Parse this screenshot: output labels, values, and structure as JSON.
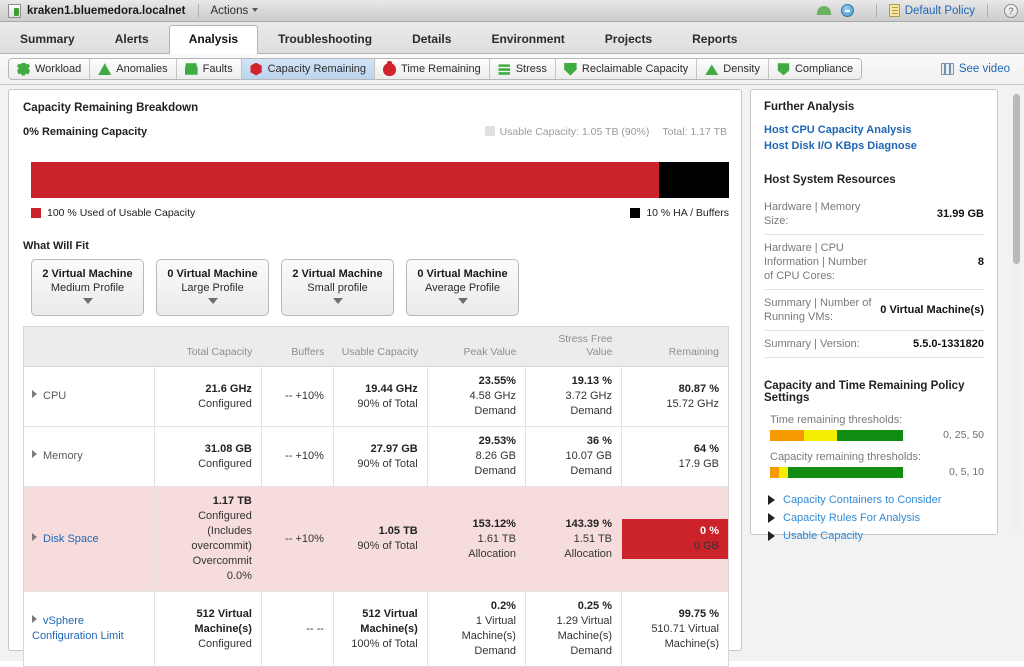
{
  "topbar": {
    "host_icon": "host-icon",
    "host_name": "kraken1.bluemedora.localnet",
    "actions_label": "Actions",
    "cloud_icon": "cloud-icon",
    "status_icon": "status-circle-icon",
    "policy_icon": "policy-icon",
    "policy_label": "Default Policy",
    "help_label": "?"
  },
  "main_tabs": [
    {
      "label": "Summary",
      "active": false
    },
    {
      "label": "Alerts",
      "active": false
    },
    {
      "label": "Analysis",
      "active": true
    },
    {
      "label": "Troubleshooting",
      "active": false
    },
    {
      "label": "Details",
      "active": false
    },
    {
      "label": "Environment",
      "active": false
    },
    {
      "label": "Projects",
      "active": false
    },
    {
      "label": "Reports",
      "active": false
    }
  ],
  "sub_tabs": [
    {
      "label": "Workload",
      "icon": "gear-badge-icon",
      "color": "#3fab42",
      "shape": "shp-gear",
      "selected": false
    },
    {
      "label": "Anomalies",
      "icon": "triangle-badge-icon",
      "color": "#3fab42",
      "shape": "shp-tri",
      "selected": false
    },
    {
      "label": "Faults",
      "icon": "stack-badge-icon",
      "color": "#3fab42",
      "shape": "shp-stack",
      "selected": false
    },
    {
      "label": "Capacity Remaining",
      "icon": "hexagon-badge-icon",
      "color": "#d2232a",
      "shape": "shp-hex",
      "selected": true
    },
    {
      "label": "Time Remaining",
      "icon": "clock-badge-icon",
      "color": "#d2232a",
      "shape": "shp-clock",
      "selected": false
    },
    {
      "label": "Stress",
      "icon": "bar-badge-icon",
      "color": "#3fab42",
      "shape": "shp-bar",
      "selected": false
    },
    {
      "label": "Reclaimable Capacity",
      "icon": "shield-badge-icon",
      "color": "#3fab42",
      "shape": "shp-shield",
      "selected": false
    },
    {
      "label": "Density",
      "icon": "mountain-badge-icon",
      "color": "#3fab42",
      "shape": "shp-mtn",
      "selected": false
    },
    {
      "label": "Compliance",
      "icon": "bolt-badge-icon",
      "color": "#3fab42",
      "shape": "shp-bolt",
      "selected": false
    }
  ],
  "see_video": {
    "label": "See video",
    "icon": "video-icon"
  },
  "breakdown": {
    "title": "Capacity Remaining Breakdown",
    "remaining_headline": "0% Remaining Capacity",
    "usable_capacity_label": "Usable Capacity: 1.05 TB (90%)",
    "total_label": "Total: 1.17 TB",
    "used_legend": "100 % Used of Usable Capacity",
    "ha_legend": "10 % HA / Buffers",
    "used_color": "#cc2229",
    "ha_color": "#000000",
    "used_pct": 90,
    "ha_pct": 10
  },
  "what_will_fit": {
    "title": "What Will Fit",
    "cards": [
      {
        "count": "2 Virtual Machine",
        "profile": "Medium Profile"
      },
      {
        "count": "0 Virtual Machine",
        "profile": "Large Profile"
      },
      {
        "count": "2 Virtual Machine",
        "profile": "Small profile"
      },
      {
        "count": "0 Virtual Machine",
        "profile": "Average Profile"
      }
    ]
  },
  "table": {
    "columns": [
      "",
      "Total Capacity",
      "Buffers",
      "Usable Capacity",
      "Peak Value",
      "Stress Free Value",
      "Remaining"
    ],
    "rows": [
      {
        "name": "CPU",
        "alert": false,
        "name_link": false,
        "total": {
          "main": "21.6 GHz",
          "sub": [
            "Configured"
          ]
        },
        "buffers": {
          "main": "",
          "sub": [
            "--  +10%"
          ]
        },
        "usable": {
          "main": "19.44 GHz",
          "sub": [
            "90% of Total"
          ]
        },
        "peak": {
          "main": "23.55%",
          "sub": [
            "4.58 GHz",
            "Demand"
          ]
        },
        "stress_free": {
          "main": "19.13 %",
          "sub": [
            "3.72 GHz",
            "Demand"
          ]
        },
        "remaining": {
          "main": "80.87 %",
          "sub": [
            "15.72 GHz"
          ],
          "highlight": false
        }
      },
      {
        "name": "Memory",
        "alert": false,
        "name_link": false,
        "total": {
          "main": "31.08 GB",
          "sub": [
            "Configured"
          ]
        },
        "buffers": {
          "main": "",
          "sub": [
            "--  +10%"
          ]
        },
        "usable": {
          "main": "27.97 GB",
          "sub": [
            "90% of Total"
          ]
        },
        "peak": {
          "main": "29.53%",
          "sub": [
            "8.26 GB",
            "Demand"
          ]
        },
        "stress_free": {
          "main": "36 %",
          "sub": [
            "10.07 GB",
            "Demand"
          ]
        },
        "remaining": {
          "main": "64 %",
          "sub": [
            "17.9 GB"
          ],
          "highlight": false
        }
      },
      {
        "name": "Disk Space",
        "alert": true,
        "name_link": true,
        "total": {
          "main": "1.17 TB",
          "sub": [
            "Configured",
            "(Includes",
            "overcommit)",
            "Overcommit",
            "0.0%"
          ]
        },
        "buffers": {
          "main": "",
          "sub": [
            "--  +10%"
          ]
        },
        "usable": {
          "main": "1.05 TB",
          "sub": [
            "90% of Total"
          ]
        },
        "peak": {
          "main": "153.12%",
          "sub": [
            "1.61 TB",
            "Allocation"
          ]
        },
        "stress_free": {
          "main": "143.39 %",
          "sub": [
            "1.51 TB",
            "Allocation"
          ]
        },
        "remaining": {
          "main": "0 %",
          "sub": [
            "0 GB"
          ],
          "highlight": true
        }
      },
      {
        "name": "vSphere Configuration Limit",
        "alert": false,
        "name_link": true,
        "total": {
          "main": "512 Virtual Machine(s)",
          "sub": [
            "Configured"
          ]
        },
        "buffers": {
          "main": "",
          "sub": [
            "--  --"
          ]
        },
        "usable": {
          "main": "512 Virtual Machine(s)",
          "sub": [
            "100% of Total"
          ]
        },
        "peak": {
          "main": "0.2%",
          "sub": [
            "1 Virtual",
            "Machine(s)",
            "Demand"
          ]
        },
        "stress_free": {
          "main": "0.25 %",
          "sub": [
            "1.29 Virtual",
            "Machine(s)",
            "Demand"
          ]
        },
        "remaining": {
          "main": "99.75 %",
          "sub": [
            "510.71 Virtual",
            "Machine(s)"
          ],
          "highlight": false
        }
      }
    ]
  },
  "further_analysis": {
    "title": "Further Analysis",
    "links": [
      "Host CPU Capacity Analysis",
      "Host Disk I/O KBps Diagnose"
    ]
  },
  "host_system_resources": {
    "title": "Host System Resources",
    "rows": [
      {
        "label": "Hardware | Memory Size:",
        "value": "31.99 GB"
      },
      {
        "label": "Hardware | CPU Information | Number of CPU Cores:",
        "value": "8"
      },
      {
        "label": "Summary | Number of Running VMs:",
        "value": "0 Virtual Machine(s)"
      },
      {
        "label": "Summary | Version:",
        "value": "5.5.0-1331820"
      }
    ]
  },
  "policy_settings": {
    "title": "Capacity and Time Remaining Policy Settings",
    "time_remaining": {
      "label": "Time remaining thresholds:",
      "values": "0, 25, 50",
      "segments": [
        {
          "color": "#f59a00",
          "width": 34
        },
        {
          "color": "#f5ee00",
          "width": 33
        },
        {
          "color": "#108c10",
          "width": 66
        }
      ]
    },
    "capacity_remaining": {
      "label": "Capacity remaining thresholds:",
      "values": "0, 5, 10",
      "segments": [
        {
          "color": "#f59a00",
          "width": 9
        },
        {
          "color": "#f5ee00",
          "width": 9
        },
        {
          "color": "#108c10",
          "width": 115
        }
      ]
    }
  },
  "expandables": [
    {
      "label": "Capacity Containers to Consider"
    },
    {
      "label": "Capacity Rules For Analysis"
    },
    {
      "label": "Usable Capacity"
    }
  ]
}
